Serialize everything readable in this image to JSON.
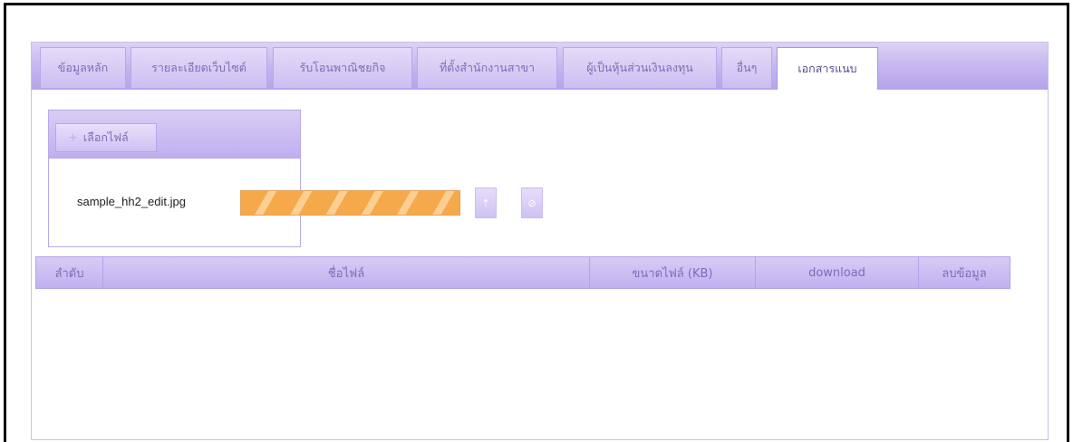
{
  "tabs": [
    {
      "label": "ข้อมูลหลัก",
      "active": false
    },
    {
      "label": "รายละเอียดเว็บไซต์",
      "active": false
    },
    {
      "label": "รับโอนพาณิชยกิจ",
      "active": false
    },
    {
      "label": "ที่ตั้งสำนักงานสาขา",
      "active": false
    },
    {
      "label": "ผู้เป็นหุ้นส่วนเงินลงทุน",
      "active": false
    },
    {
      "label": "อื่นๆ",
      "active": false
    },
    {
      "label": "เอกสารแนบ",
      "active": true
    }
  ],
  "uploader": {
    "choose_label": "เลือกไฟล์",
    "choose_icon": "plus-icon",
    "file_name": "sample_hh2_edit.jpg",
    "progress": 1.0,
    "colors": {
      "progress_a": "#f6a94b",
      "progress_b": "#fbcf93"
    }
  },
  "table": {
    "headers": [
      "ลำดับ",
      "ชื่อไฟล์",
      "ขนาดไฟล์ (KB)",
      "download",
      "ลบข้อมูล"
    ],
    "rows": []
  },
  "colors": {
    "accent": "#c1b0f0",
    "text": "#7f6db5"
  }
}
